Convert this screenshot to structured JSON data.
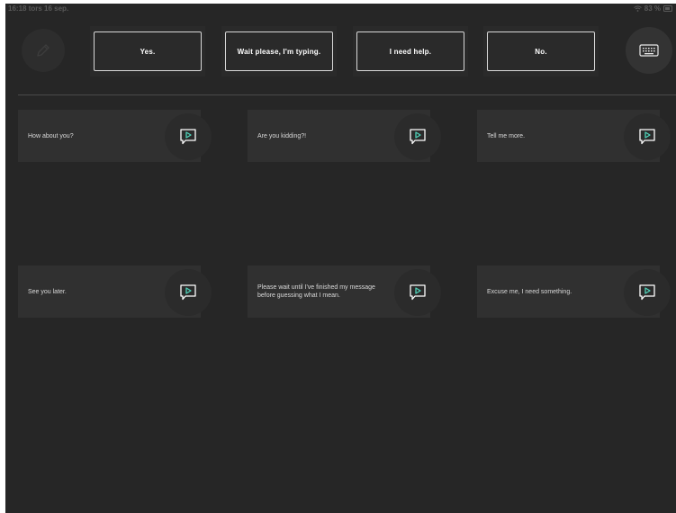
{
  "status": {
    "time": "16:18",
    "date": "tors 16 sep.",
    "battery": "83 %"
  },
  "toolbar": {
    "edit_icon": "pencil-icon",
    "keyboard_icon": "keyboard-icon",
    "quick_replies": [
      "Yes.",
      "Wait please, I'm typing.",
      "I need help.",
      "No."
    ]
  },
  "phrases": [
    "How about you?",
    "Are you kidding?!",
    "Tell me more.",
    "See you later.",
    "Please wait until I've finished my message before guessing what I mean.",
    "Excuse me, I need something."
  ],
  "icons": {
    "speak": "speech-bubble-play-icon"
  },
  "colors": {
    "background": "#262626",
    "accent": "#4fd1b8",
    "tile": "#303030"
  }
}
